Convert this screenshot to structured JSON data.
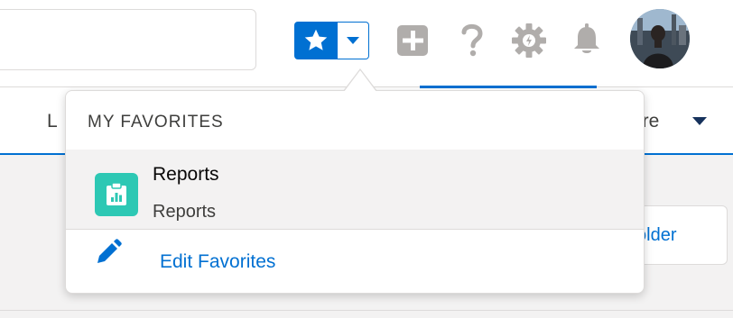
{
  "header": {
    "search": {
      "placeholder": ""
    },
    "icons": {
      "favorites_star": "star-icon",
      "favorites_menu": "chevron-down-icon",
      "global_actions": "add-icon",
      "help": "help-icon",
      "setup": "gear-icon",
      "notifications": "bell-icon",
      "avatar": "avatar"
    }
  },
  "nav": {
    "left_item": "L",
    "more_label": "ore"
  },
  "content": {
    "folder_button_label": "older"
  },
  "favorites_panel": {
    "heading": "MY FAVORITES",
    "items": [
      {
        "title": "Reports",
        "subtitle": "Reports",
        "icon": "report-icon"
      }
    ],
    "edit_label": "Edit Favorites",
    "edit_icon": "pencil-icon"
  },
  "colors": {
    "brand": "#0070d2",
    "report_icon_bg": "#2dc8b4",
    "icon_gray": "#b0adab",
    "hover_bg": "#f3f2f2"
  }
}
